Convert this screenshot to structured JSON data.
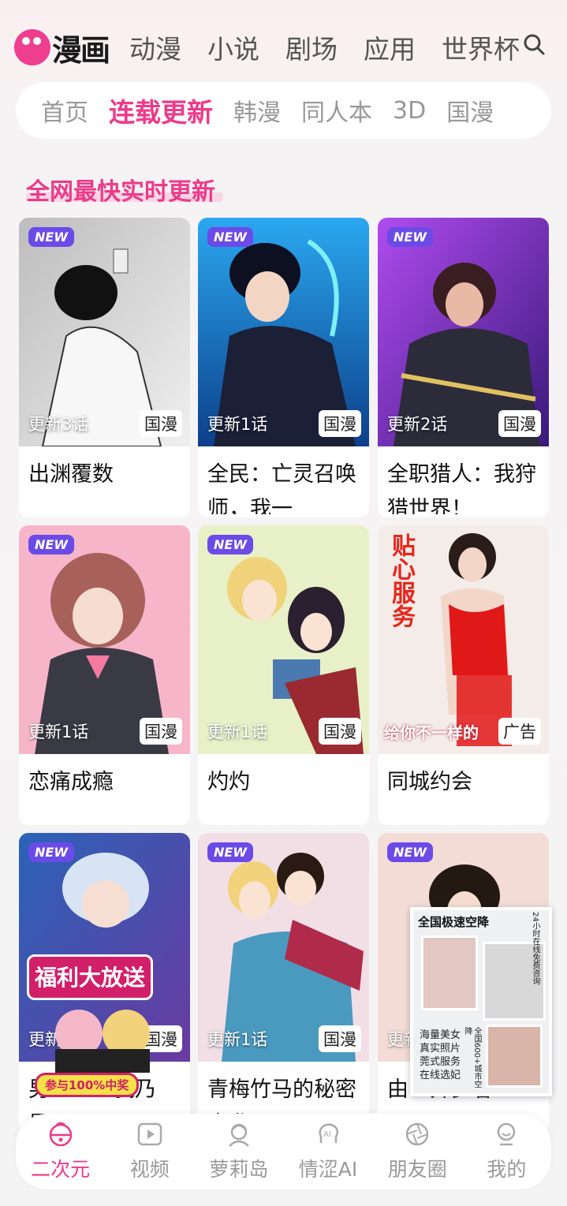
{
  "brand": {
    "logo_text": "漫画",
    "accent": "#ee3a8a"
  },
  "top_nav": [
    "动漫",
    "小说",
    "剧场",
    "应用",
    "世界杯"
  ],
  "categories": {
    "items": [
      "首页",
      "连载更新",
      "韩漫",
      "同人本",
      "3D",
      "国漫"
    ],
    "active": "连载更新"
  },
  "section_title": "全网最快实时更新",
  "cards": [
    {
      "title": "出渊覆数",
      "badge": "NEW",
      "update": "更新3话",
      "tag": "国漫"
    },
    {
      "title": "全民：亡灵召唤师，我一",
      "badge": "NEW",
      "update": "更新1话",
      "tag": "国漫"
    },
    {
      "title": "全职猎人：我狩猎世界！",
      "badge": "NEW",
      "update": "更新2话",
      "tag": "国漫"
    },
    {
      "title": "恋痛成瘾",
      "badge": "NEW",
      "update": "更新1话",
      "tag": "国漫"
    },
    {
      "title": "灼灼",
      "badge": "NEW",
      "update": "更新1话",
      "tag": "国漫"
    },
    {
      "title": "同城约会",
      "badge": "",
      "update": "",
      "tag": "广告",
      "overlay_text": "贴心服务",
      "overlay_bottom": "给你不一样的"
    },
    {
      "title": "男主……我乃是…",
      "badge": "NEW",
      "update": "更新",
      "tag": "国漫"
    },
    {
      "title": "青梅竹马的秘密来袭",
      "badge": "NEW",
      "update": "更新1话",
      "tag": "国漫"
    },
    {
      "title": "由…异乡客",
      "badge": "NEW",
      "update": "更新",
      "tag": ""
    }
  ],
  "promo": {
    "title": "福利大放送",
    "subtitle": "参与100%中奖"
  },
  "float_ad": {
    "heading": "全国极速空降",
    "side_text": "24小时在线免费咨询",
    "lines": [
      "海量美女",
      "真实照片",
      "莞式服务",
      "在线选妃"
    ],
    "corner": "全国600+城市空降"
  },
  "bottom_tabs": [
    "二次元",
    "视频",
    "萝莉岛",
    "情涩AI",
    "朋友圈",
    "我的"
  ],
  "active_tab": "二次元"
}
